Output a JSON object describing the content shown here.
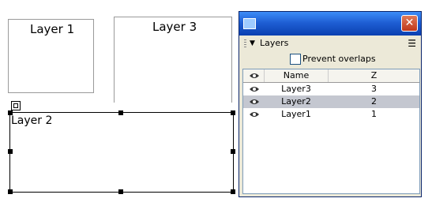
{
  "canvas": {
    "layers": [
      {
        "label": "Layer 1"
      },
      {
        "label": "Layer 3"
      },
      {
        "label": "Layer 2"
      }
    ]
  },
  "layers_window": {
    "close_glyph": "✕",
    "panel_title": "Layers",
    "prevent_overlaps": {
      "label": "Prevent overlaps",
      "checked": false
    },
    "table": {
      "columns": {
        "name": "Name",
        "z": "Z"
      },
      "rows": [
        {
          "name": "Layer3",
          "z": "3",
          "selected": false
        },
        {
          "name": "Layer2",
          "z": "2",
          "selected": true
        },
        {
          "name": "Layer1",
          "z": "1",
          "selected": false
        }
      ]
    }
  },
  "icons": {
    "visibility": "eye-icon",
    "collapse": "triangle-down-icon",
    "options": "list-menu-icon",
    "close": "close-icon"
  },
  "colors": {
    "titlebar": "#1f5fd4",
    "panel_bg": "#ece9d8",
    "close_red": "#c0371a",
    "selected_row": "#c4c7d0"
  }
}
